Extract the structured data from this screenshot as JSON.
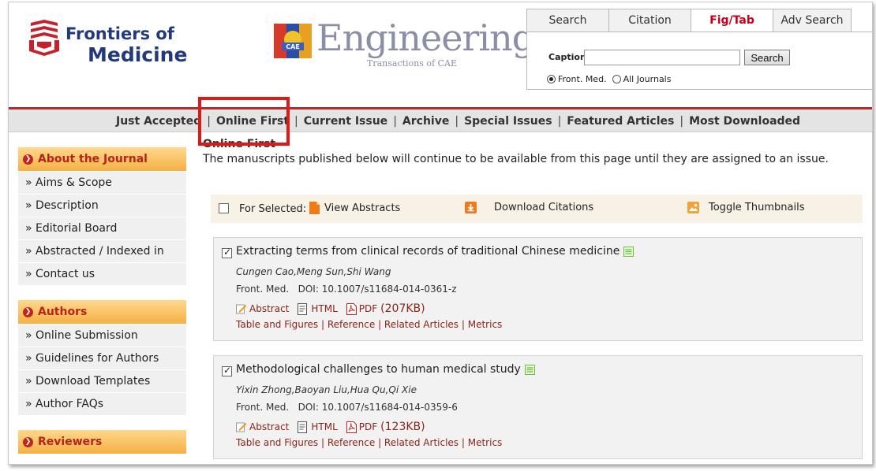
{
  "header": {
    "journal_line1": "Frontiers of",
    "journal_line2": "Medicine",
    "partner_title": "Engineering",
    "partner_subtitle": "Transactions of CAE",
    "cae_text": "CAE"
  },
  "search": {
    "tabs": [
      "Search",
      "Citation",
      "Fig/Tab",
      "Adv Search"
    ],
    "active_tab": "Fig/Tab",
    "caption_label": "Caption",
    "caption_value": "",
    "button_label": "Search",
    "radio_options": [
      "Front. Med.",
      "All Journals"
    ],
    "selected_radio": "Front. Med."
  },
  "nav": {
    "items": [
      "Just Accepted",
      "Online First",
      "Current Issue",
      "Archive",
      "Special Issues",
      "Featured Articles",
      "Most Downloaded"
    ],
    "highlighted": "Online First"
  },
  "sidebar": {
    "sections": [
      {
        "heading": "About the Journal",
        "items": [
          "» Aims & Scope",
          "» Description",
          "» Editorial Board",
          "» Abstracted / Indexed in",
          "» Contact us"
        ]
      },
      {
        "heading": "Authors",
        "items": [
          "» Online Submission",
          "» Guidelines for Authors",
          "» Download Templates",
          "» Author FAQs"
        ]
      },
      {
        "heading": "Reviewers",
        "items": []
      }
    ]
  },
  "main": {
    "title": "Online First",
    "description": "The manuscripts published below will continue to be available from this page until they are assigned to an issue.",
    "toolbar": {
      "for_selected": "For Selected:",
      "view_abstracts": "View Abstracts",
      "download_citations": "Download Citations",
      "toggle_thumbnails": "Toggle Thumbnails"
    },
    "articles": [
      {
        "checked": true,
        "title": "Extracting terms from clinical records of traditional Chinese medicine",
        "authors": "Cungen Cao,Meng Sun,Shi Wang",
        "journal": "Front. Med.",
        "doi": "DOI: 10.1007/s11684-014-0361-z",
        "abstract_label": "Abstract",
        "html_label": "HTML",
        "pdf_label": "PDF",
        "pdf_size": "(207KB)",
        "links": [
          "Table and Figures",
          "Reference",
          "Related Articles",
          "Metrics"
        ]
      },
      {
        "checked": true,
        "title": "Methodological challenges to human medical study",
        "authors": "Yixin Zhong,Baoyan Liu,Hua Qu,Qi Xie",
        "journal": "Front. Med.",
        "doi": "DOI: 10.1007/s11684-014-0359-6",
        "abstract_label": "Abstract",
        "html_label": "HTML",
        "pdf_label": "PDF",
        "pdf_size": "(123KB)",
        "links": [
          "Table and Figures",
          "Reference",
          "Related Articles",
          "Metrics"
        ]
      }
    ]
  },
  "colors": {
    "brand_red": "#c4001a",
    "nav_border": "#b22a2a",
    "journal_blue": "#223a7a",
    "link_brown": "#8a2418",
    "sidebar_head": "#f5b043"
  }
}
